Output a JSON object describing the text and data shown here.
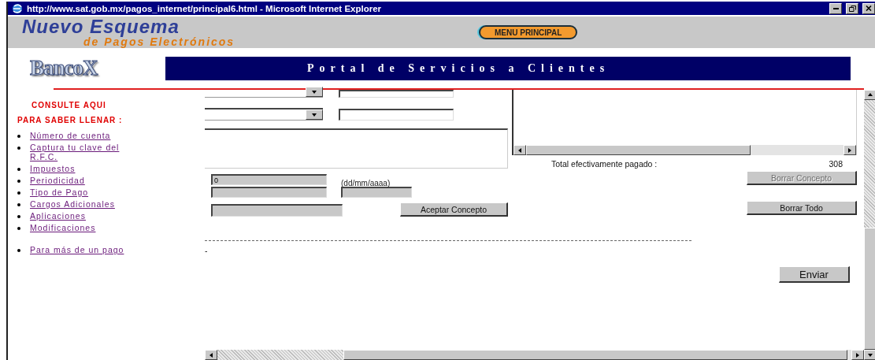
{
  "window": {
    "title": "http://www.sat.gob.mx/pagos_internet/principal6.html - Microsoft Internet Explorer"
  },
  "header": {
    "logo_title": "Nuevo Esquema",
    "logo_subtitle": "de Pagos Electrónicos",
    "menu_button": "MENU PRINCIPAL"
  },
  "bank_logo": "BancoX",
  "banner": "Portal de Servicios a Clientes",
  "sidebar": {
    "heading": "CONSULTE AQUI",
    "subheading": "PARA SABER LLENAR :",
    "links": [
      "Número de cuenta",
      "Captura tu clave del R.F.C.",
      "Impuestos",
      "Periodicidad",
      "Tipo de Pago",
      "Cargos Adicionales",
      "Aplicaciones",
      "Modificaciones"
    ],
    "extra_links": [
      "Para más de un pago"
    ]
  },
  "form": {
    "amount_value": "0",
    "date_hint": "(dd/mm/aaaa)",
    "accept_button": "Aceptar Concepto",
    "total_label": "Total  efectivamente pagado :",
    "total_value": "308",
    "delete_concept_button": {
      "label": "Borrar Concepto",
      "disabled": true
    },
    "delete_all_button": {
      "label": "Borrar Todo",
      "disabled": false
    },
    "dash_mark": "-",
    "send_button": "Enviar"
  }
}
